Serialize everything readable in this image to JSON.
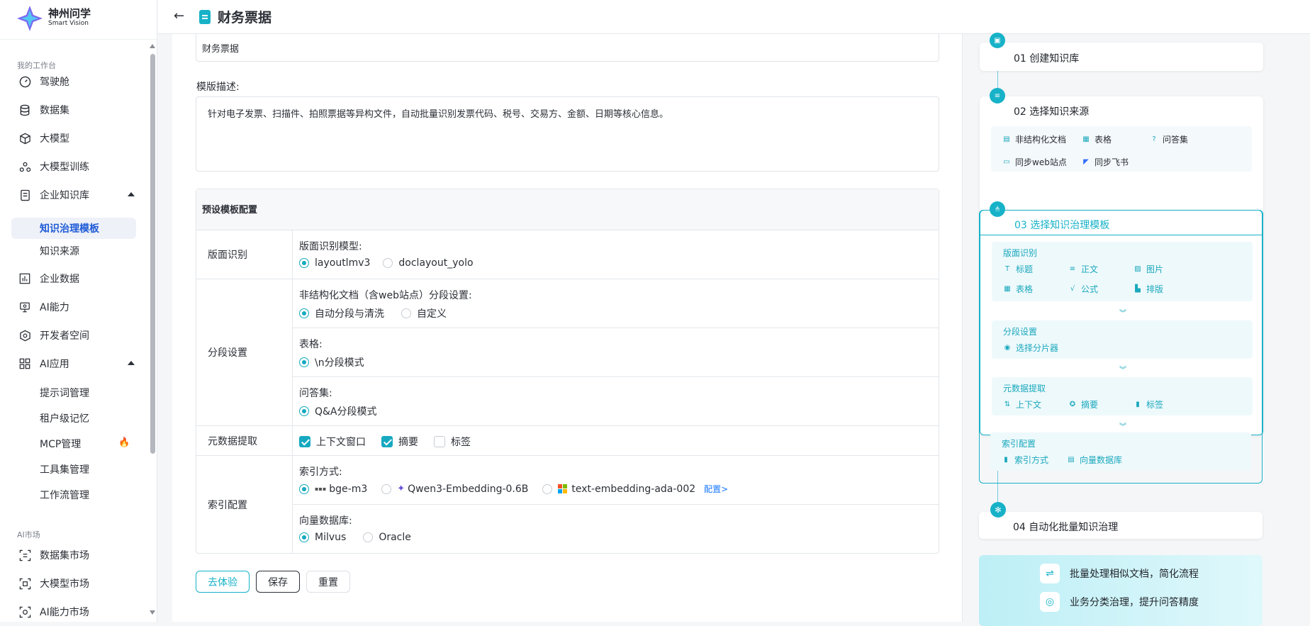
{
  "app": {
    "name_cn": "神州问学",
    "name_en": "Smart Vision"
  },
  "header": {
    "back": "←",
    "title": "财务票据"
  },
  "sidebar": {
    "section_workspace": "我的工作台",
    "items": [
      {
        "label": "驾驶舱",
        "icon": "gauge-icon"
      },
      {
        "label": "数据集",
        "icon": "database-icon"
      },
      {
        "label": "大模型",
        "icon": "cube-icon"
      },
      {
        "label": "大模型训练",
        "icon": "training-icon"
      },
      {
        "label": "企业知识库",
        "icon": "knowledge-icon"
      },
      {
        "label": "企业数据",
        "icon": "chart-icon"
      },
      {
        "label": "AI能力",
        "icon": "monitor-icon"
      },
      {
        "label": "开发者空间",
        "icon": "developer-icon"
      },
      {
        "label": "AI应用",
        "icon": "apps-icon"
      }
    ],
    "kb_sub": [
      "知识治理模板",
      "知识来源"
    ],
    "ai_sub": [
      "提示词管理",
      "租户级记忆",
      "MCP管理",
      "工具集管理",
      "工作流管理"
    ],
    "section_market": "AI市场",
    "market": [
      "数据集市场",
      "大模型市场",
      "AI能力市场"
    ]
  },
  "form": {
    "name_value": "财务票据",
    "desc_label": "模版描述:",
    "desc_value": "针对电子发票、扫描件、拍照票据等异构文件，自动批量识别发票代码、税号、交易方、金额、日期等核心信息。",
    "config_title": "预设模板配置",
    "layout_key": "版面识别",
    "layout_q": "版面识别模型:",
    "layout_opts": [
      "layoutlmv3",
      "doclayout_yolo"
    ],
    "seg_key": "分段设置",
    "seg_q1": "非结构化文档（含web站点）分段设置:",
    "seg_opts1": [
      "自动分段与清洗",
      "自定义"
    ],
    "seg_q2": "表格:",
    "seg_opt2": "\\n分段模式",
    "seg_q3": "问答集:",
    "seg_opt3": "Q&A分段模式",
    "meta_key": "元数据提取",
    "meta_opts": [
      "上下文窗口",
      "摘要",
      "标签"
    ],
    "index_key": "索引配置",
    "index_q1": "索引方式:",
    "index_opts": [
      "bge-m3",
      "Qwen3-Embedding-0.6B",
      "text-embedding-ada-002"
    ],
    "index_link": "配置>",
    "index_q2": "向量数据库:",
    "vdb_opts": [
      "Milvus",
      "Oracle"
    ],
    "btn_try": "去体验",
    "btn_save": "保存",
    "btn_reset": "重置"
  },
  "flow": {
    "step1": "01 创建知识库",
    "step2": "02 选择知识来源",
    "sources": [
      "非结构化文档",
      "表格",
      "问答集",
      "同步web站点",
      "同步飞书"
    ],
    "step3": "03 选择知识治理模板",
    "g1": "版面识别",
    "g1_items": [
      "标题",
      "正文",
      "图片",
      "表格",
      "公式",
      "排版"
    ],
    "g2": "分段设置",
    "g2_items": [
      "选择分片器"
    ],
    "g3": "元数据提取",
    "g3_items": [
      "上下文",
      "摘要",
      "标签"
    ],
    "g4": "索引配置",
    "g4_items": [
      "索引方式",
      "向量数据库"
    ],
    "step4": "04 自动化批量知识治理",
    "benefits": [
      "批量处理相似文档，简化流程",
      "业务分类治理，提升问答精度"
    ]
  },
  "colors": {
    "accent": "#17b2c8",
    "active_nav": "#1e5bd6",
    "hot": "#e8453c"
  }
}
